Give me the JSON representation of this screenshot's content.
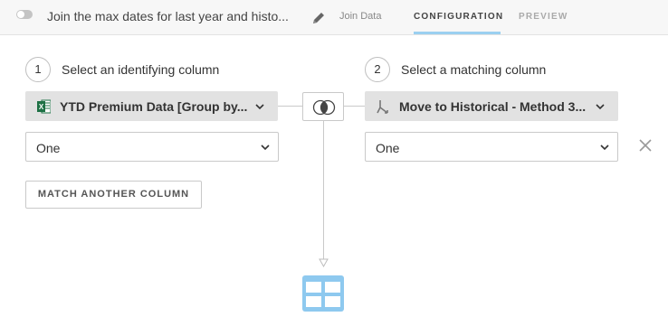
{
  "header": {
    "step_title": "Join the max dates for last year and histo...",
    "step_type": "Join Data",
    "tabs": {
      "configuration": "CONFIGURATION",
      "preview": "PREVIEW"
    }
  },
  "left": {
    "step_number": "1",
    "step_label": "Select an identifying column",
    "dataset_name": "YTD Premium Data [Group by...",
    "dataset_icon": "excel-icon",
    "column_value": "One",
    "match_button": "MATCH ANOTHER COLUMN"
  },
  "right": {
    "step_number": "2",
    "step_label": "Select a matching column",
    "dataset_name": "Move to Historical - Method 3...",
    "dataset_icon": "dataflow-icon",
    "column_value": "One"
  },
  "colors": {
    "accent": "#9bd0f0",
    "table_icon": "#8ec9ef",
    "excel_green": "#1e7145"
  }
}
